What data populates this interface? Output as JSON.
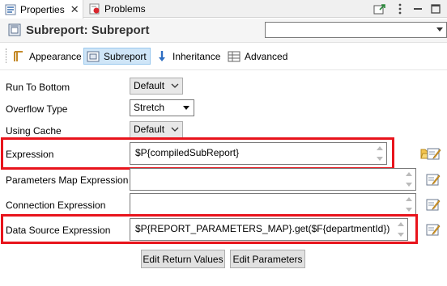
{
  "tabs": {
    "properties": "Properties",
    "close": "✕",
    "problems": "Problems"
  },
  "header": {
    "title": "Subreport: Subreport",
    "selector_value": ""
  },
  "section_tabs": {
    "appearance": "Appearance",
    "subreport": "Subreport",
    "inheritance": "Inheritance",
    "advanced": "Advanced"
  },
  "properties": {
    "run_to_bottom": {
      "label": "Run To Bottom",
      "value": "Default"
    },
    "overflow_type": {
      "label": "Overflow Type",
      "value": "Stretch"
    },
    "using_cache": {
      "label": "Using Cache",
      "value": "Default"
    },
    "expression": {
      "label": "Expression",
      "value": "$P{compiledSubReport}"
    },
    "parameters_map_expression": {
      "label": "Parameters Map Expression",
      "value": ""
    },
    "connection_expression": {
      "label": "Connection Expression",
      "value": ""
    },
    "data_source_expression": {
      "label": "Data Source Expression",
      "value": "$P{REPORT_PARAMETERS_MAP}.get($F{departmentId})"
    }
  },
  "buttons": {
    "edit_return_values": "Edit Return Values",
    "edit_parameters": "Edit Parameters"
  },
  "colors": {
    "highlight_border": "#e8141c",
    "selected_tab_bg": "#cfe5f7"
  }
}
